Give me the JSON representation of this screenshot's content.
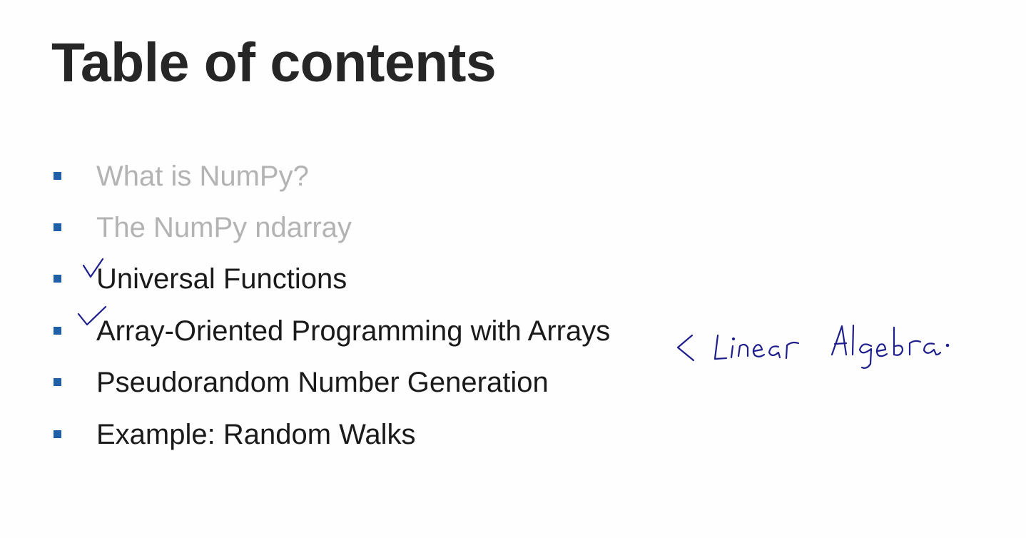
{
  "slide": {
    "title": "Table of contents",
    "accent_color": "#1f5fa8",
    "dimmed_text_color": "#b3b3b3",
    "items": [
      {
        "label": "What is NumPy?",
        "state": "dimmed"
      },
      {
        "label": "The NumPy ndarray",
        "state": "dimmed"
      },
      {
        "label": "Universal Functions",
        "state": "active",
        "checked": true
      },
      {
        "label": "Array-Oriented Programming with Arrays",
        "state": "active",
        "checked": true
      },
      {
        "label": "Pseudorandom Number Generation",
        "state": "active"
      },
      {
        "label": "Example: Random Walks",
        "state": "active"
      }
    ]
  },
  "annotations": {
    "ink_color": "#1e1e8c",
    "handwritten_note": "< Linear Algebra."
  }
}
